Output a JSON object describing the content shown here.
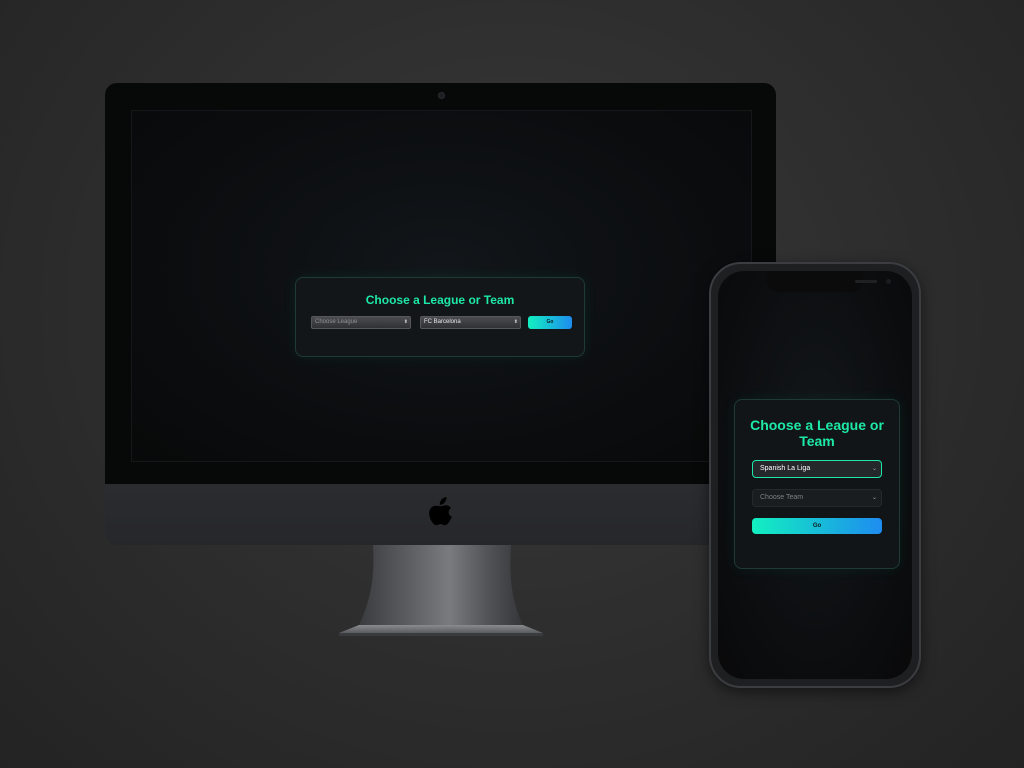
{
  "desktop": {
    "title": "Choose a League or Team",
    "league_select": {
      "value": "Choose League",
      "caret": "⬍"
    },
    "team_select": {
      "value": "FC Barcelona",
      "caret": "⬍"
    },
    "go_label": "Go"
  },
  "mobile": {
    "title": "Choose a League or Team",
    "league_select": {
      "value": "Spanish La Liga",
      "caret": "⌄"
    },
    "team_select": {
      "value": "Choose Team",
      "caret": "⌄"
    },
    "go_label": "Go"
  },
  "colors": {
    "accent": "#1de9a4",
    "button_gradient_start": "#12f0c0",
    "button_gradient_end": "#1e8cf0",
    "background": "#2f2f2f"
  }
}
